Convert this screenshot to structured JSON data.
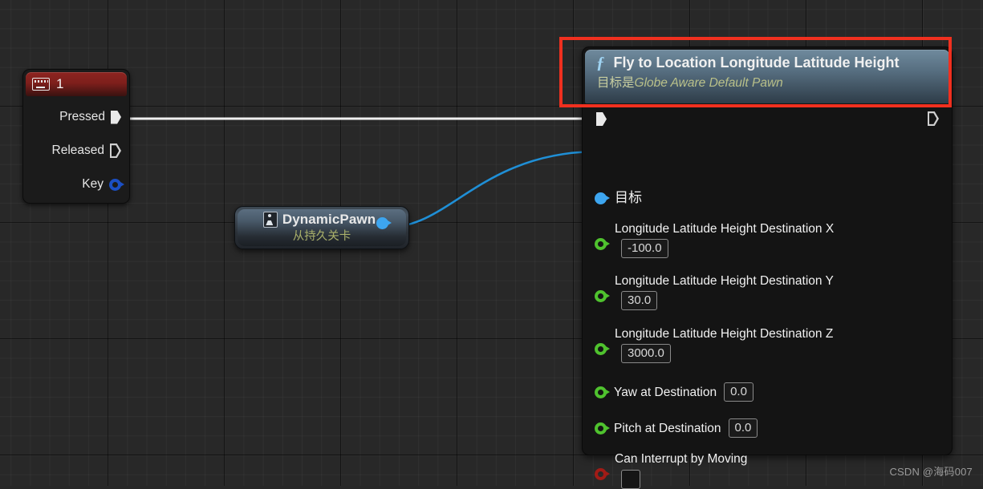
{
  "graph": {
    "background_color": "#282828",
    "grid_color": "#2f2f2f"
  },
  "keyboard_node": {
    "icon": "keyboard-icon",
    "title": "1",
    "header_color": "#8e2420",
    "pins": [
      {
        "label": "Pressed",
        "type": "exec",
        "state": "connected"
      },
      {
        "label": "Released",
        "type": "exec",
        "state": "unconnected"
      },
      {
        "label": "Key",
        "type": "struct",
        "color": "#1b4fc4"
      }
    ]
  },
  "pawn_node": {
    "icon": "pawn-icon",
    "title": "DynamicPawn",
    "subtitle": "从持久关卡",
    "subtitle_color": "#a9b06a",
    "output_pin_color": "#3da5ef"
  },
  "function_node": {
    "icon": "function-icon",
    "title": "Fly to Location Longitude Latitude Height",
    "subtitle_prefix": "目标是",
    "subtitle_target": "Globe Aware Default Pawn",
    "header_color": "#556c7e",
    "exec_in": {
      "label": "",
      "state": "connected"
    },
    "exec_out": {
      "label": "",
      "state": "unconnected"
    },
    "pins": [
      {
        "label": "目标",
        "pin_color": "#3da5ef",
        "pin_style": "filled",
        "value": null
      },
      {
        "label": "Longitude Latitude Height Destination X",
        "pin_color": "#4fc22e",
        "pin_style": "ring",
        "value": "-100.0"
      },
      {
        "label": "Longitude Latitude Height Destination Y",
        "pin_color": "#4fc22e",
        "pin_style": "ring",
        "value": "30.0"
      },
      {
        "label": "Longitude Latitude Height Destination Z",
        "pin_color": "#4fc22e",
        "pin_style": "ring",
        "value": "3000.0"
      },
      {
        "label": "Yaw at Destination",
        "pin_color": "#4fc22e",
        "pin_style": "ring",
        "value": "0.0"
      },
      {
        "label": "Pitch at Destination",
        "pin_color": "#4fc22e",
        "pin_style": "ring",
        "value": "0.0"
      },
      {
        "label": "Can Interrupt by Moving",
        "pin_color": "#a11b16",
        "pin_style": "ring",
        "value": "",
        "checked": false
      }
    ]
  },
  "annotation": {
    "color": "#f0301f",
    "shape": "rectangle"
  },
  "watermark": {
    "text": "CSDN @海码007"
  }
}
